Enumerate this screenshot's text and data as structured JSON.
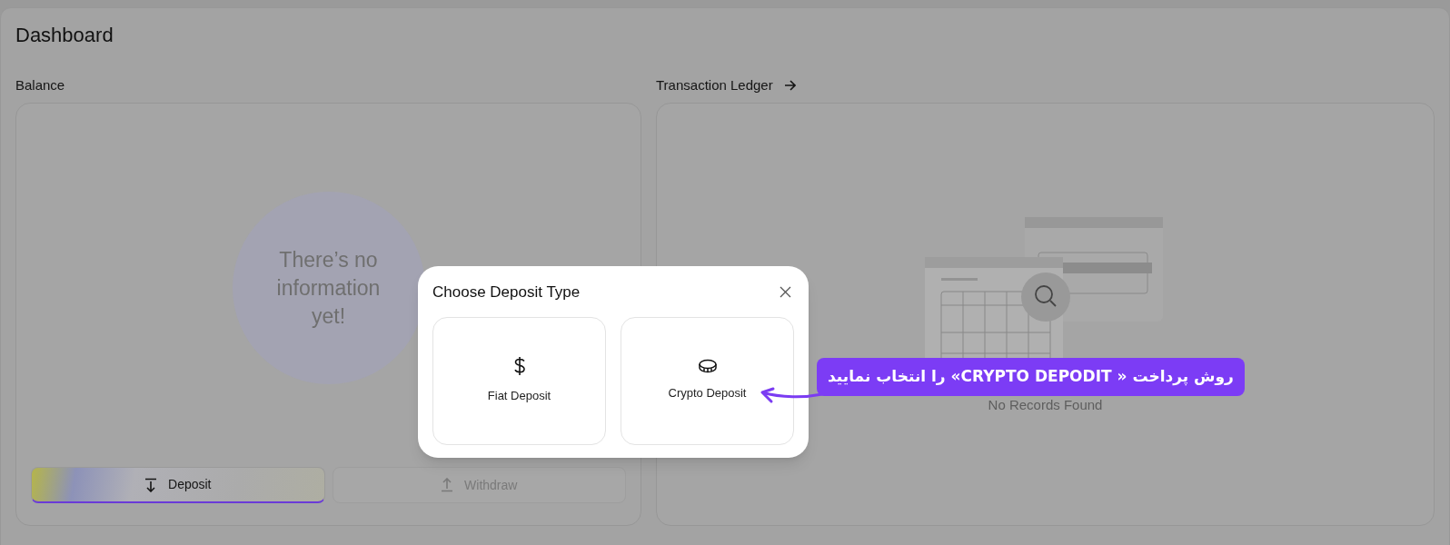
{
  "page": {
    "title": "Dashboard"
  },
  "balance": {
    "label": "Balance",
    "empty_text": "There’s no information yet!",
    "buttons": [
      {
        "label": "Deposit",
        "kind": "deposit",
        "disabled": false
      },
      {
        "label": "Withdraw",
        "kind": "withdraw",
        "disabled": true
      }
    ]
  },
  "ledger": {
    "label": "Transaction Ledger",
    "empty_text": "No Records Found"
  },
  "dialog": {
    "title": "Choose Deposit Type",
    "options": [
      {
        "label": "Fiat Deposit",
        "kind": "fiat"
      },
      {
        "label": "Crypto Deposit",
        "kind": "crypto"
      }
    ]
  },
  "callout": {
    "text": "روش پرداخت « CRYPTO DEPODIT» را انتخاب نمایید"
  }
}
